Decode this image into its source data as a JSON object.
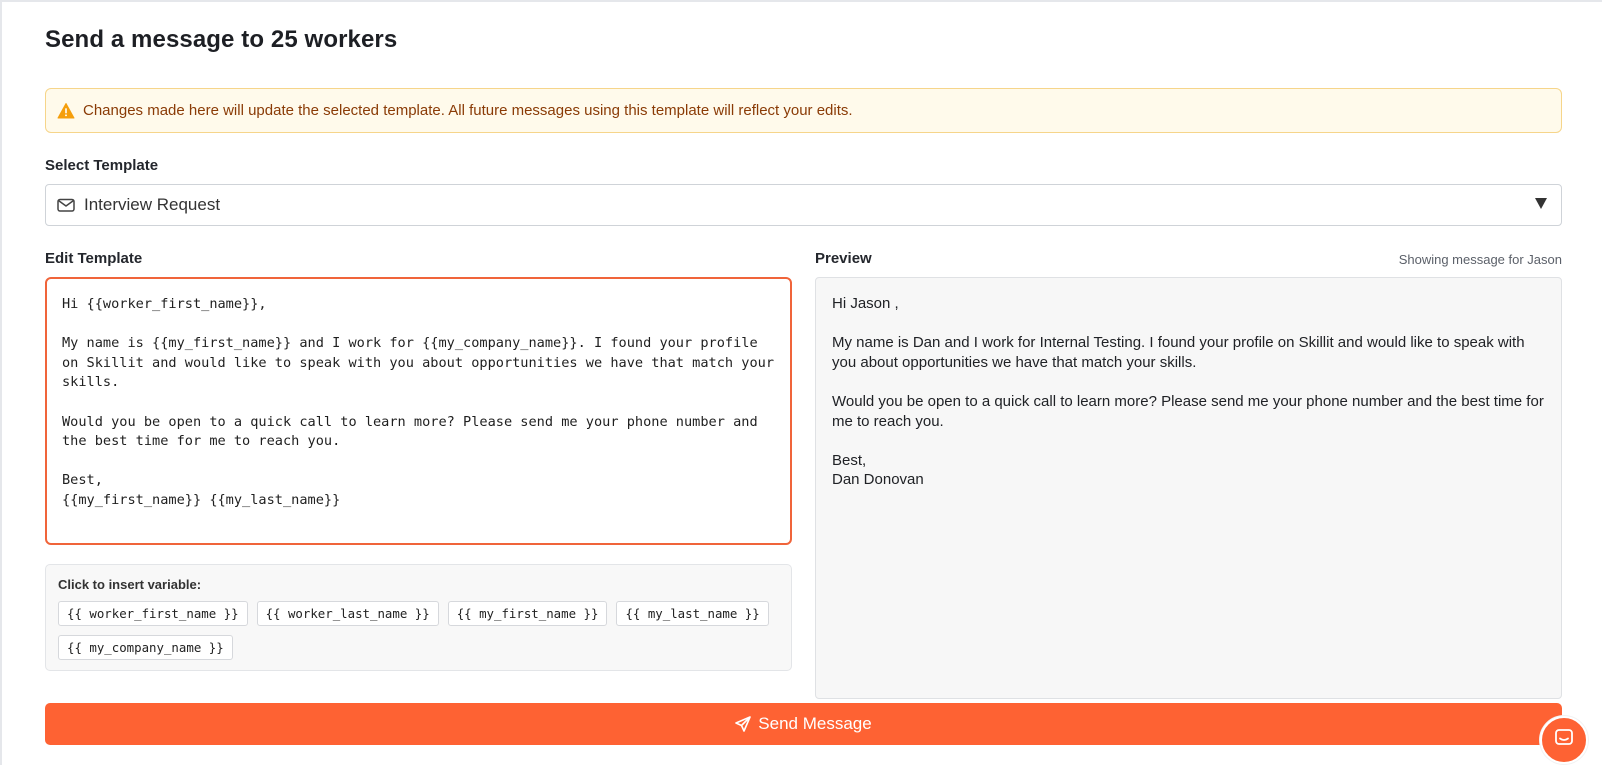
{
  "page": {
    "title": "Send a message to 25 workers"
  },
  "warning": {
    "text": "Changes made here will update the selected template. All future messages using this template will reflect your edits.",
    "icon": "warning-triangle-icon"
  },
  "template_select": {
    "label": "Select Template",
    "value": "Interview Request",
    "icon": "mail-icon"
  },
  "editor": {
    "label": "Edit Template",
    "content": "Hi {{worker_first_name}},\n\nMy name is {{my_first_name}} and I work for {{my_company_name}}. I found your profile on Skillit and would like to speak with you about opportunities we have that match your skills.\n\nWould you be open to a quick call to learn more? Please send me your phone number and the best time for me to reach you.\n\nBest,\n{{my_first_name}} {{my_last_name}}"
  },
  "variables": {
    "label": "Click to insert variable:",
    "items": [
      "{{ worker_first_name }}",
      "{{ worker_last_name }}",
      "{{ my_first_name }}",
      "{{ my_last_name }}",
      "{{ my_company_name }}"
    ]
  },
  "preview": {
    "label": "Preview",
    "note": "Showing message for Jason",
    "content": "Hi Jason ,\n\nMy name is Dan and I work for Internal Testing. I found your profile on Skillit and would like to speak with you about opportunities we have that match your skills.\n\nWould you be open to a quick call to learn more? Please send me your phone number and the best time for me to reach you.\n\nBest,\nDan Donovan"
  },
  "send_button": {
    "label": "Send Message",
    "icon": "paper-plane-icon"
  },
  "colors": {
    "accent": "#fe6233",
    "warning_bg": "#fffaeb",
    "warning_border": "#f6d58a",
    "warning_text": "#8a3b06",
    "warning_icon": "#f59e0b"
  }
}
